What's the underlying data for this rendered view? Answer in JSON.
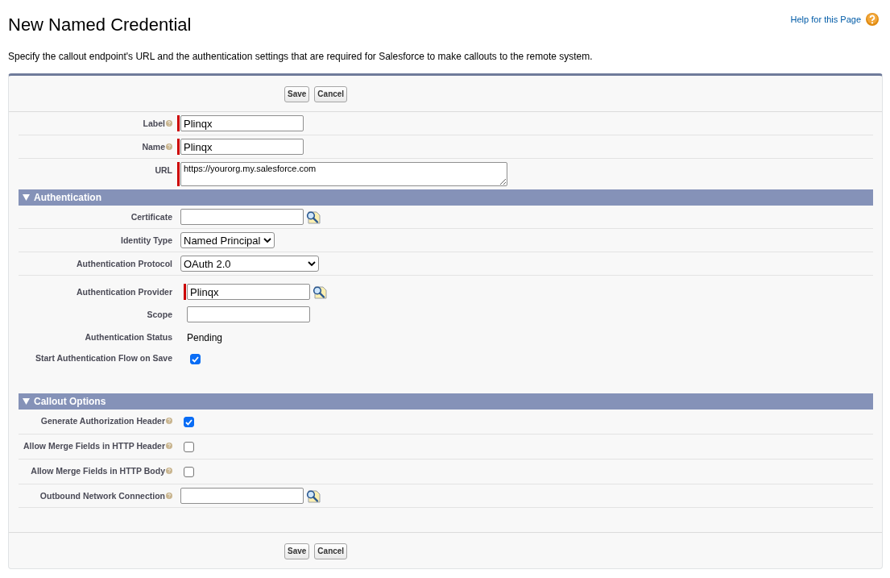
{
  "page": {
    "title": "New Named Credential",
    "help_link": "Help for this Page"
  },
  "description": "Specify the callout endpoint's URL and the authentication settings that are required for Salesforce to make callouts to the remote system.",
  "form": {
    "top_buttons": [
      "Save",
      "Cancel"
    ],
    "fields": [
      {
        "kind": "text",
        "label": "Label",
        "help": true,
        "required": true,
        "value": "Plinqx"
      },
      {
        "kind": "text",
        "label": "Name",
        "help": true,
        "required": true,
        "value": "Plinqx"
      },
      {
        "kind": "textarea",
        "label": "URL",
        "help": false,
        "required": true,
        "value": "https://yourorg.my.salesforce.com"
      }
    ],
    "sections": [
      {
        "title": "Authentication",
        "expanded": true,
        "fields": [
          {
            "kind": "lookup",
            "label": "Certificate",
            "help": false,
            "required": false
          },
          {
            "kind": "select",
            "label": "Identity Type",
            "help": false,
            "required": false,
            "value": "Named Principal"
          },
          {
            "kind": "select",
            "label": "Authentication Protocol",
            "help": false,
            "required": false,
            "value": "OAuth 2.0"
          }
        ],
        "subfields": [
          {
            "kind": "lookup",
            "label": "Authentication Provider",
            "help": false,
            "required": true,
            "value": "Plinqx"
          },
          {
            "kind": "text",
            "label": "Scope",
            "help": false,
            "required": false
          },
          {
            "kind": "static",
            "label": "Authentication Status",
            "help": false,
            "value": "Pending"
          },
          {
            "kind": "checkbox",
            "label": "Start Authentication Flow on Save",
            "help": false,
            "checked": true
          }
        ]
      },
      {
        "title": "Callout Options",
        "expanded": true,
        "fields": [
          {
            "kind": "checkbox",
            "label": "Generate Authorization Header",
            "help": true,
            "checked": true
          },
          {
            "kind": "checkbox",
            "label": "Allow Merge Fields in HTTP Header",
            "help": true,
            "checked": false
          },
          {
            "kind": "checkbox",
            "label": "Allow Merge Fields in HTTP Body",
            "help": true,
            "checked": false
          },
          {
            "kind": "lookup",
            "label": "Outbound Network Connection",
            "help": true,
            "required": false
          }
        ]
      }
    ],
    "bottom_buttons": [
      "Save",
      "Cancel"
    ]
  }
}
